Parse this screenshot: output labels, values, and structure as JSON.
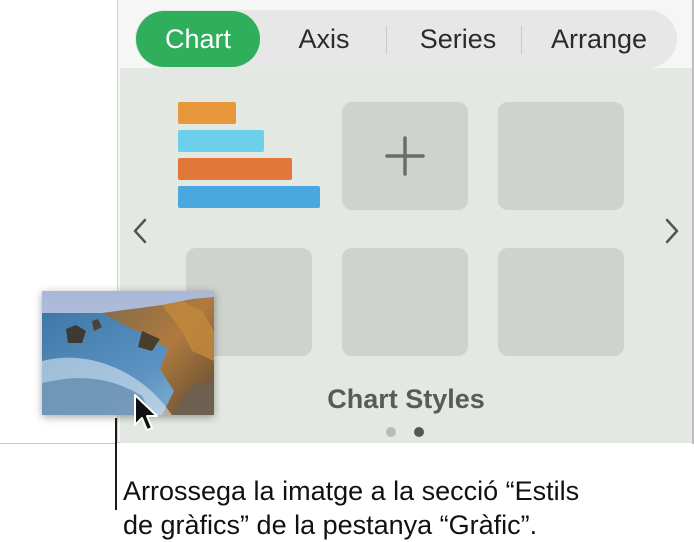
{
  "tabs": [
    {
      "label": "Chart",
      "active": true
    },
    {
      "label": "Axis",
      "active": false
    },
    {
      "label": "Series",
      "active": false
    },
    {
      "label": "Arrange",
      "active": false
    }
  ],
  "styles": {
    "section_title": "Chart Styles",
    "add_icon": "plus-icon",
    "prev_icon": "chevron-left-icon",
    "next_icon": "chevron-right-icon",
    "page_count": 2,
    "current_page": 2,
    "first_tile_bar_colors": [
      "#e8973a",
      "#6dd0ea",
      "#e1773a",
      "#4aa8e0"
    ]
  },
  "drag": {
    "image_subject": "coastline photo",
    "cursor_icon": "arrow-cursor-icon"
  },
  "callout": {
    "line1": "Arrossega la imatge a la secció “Estils",
    "line2": "de gràfics” de la pestanya “Gràfic”."
  },
  "colors": {
    "accent": "#2fae5b",
    "panel_bg": "#e3e8e2",
    "tile_bg": "#cfd3ce"
  }
}
